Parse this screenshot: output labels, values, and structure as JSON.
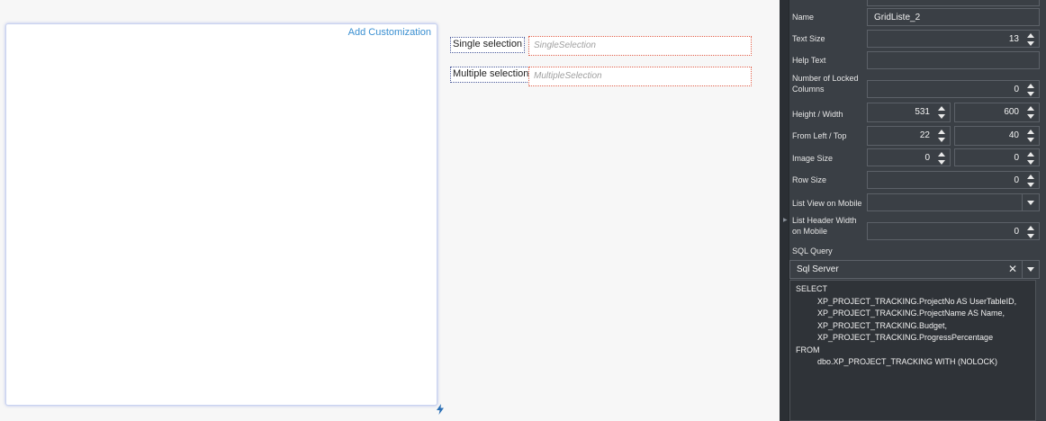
{
  "canvas": {
    "add_customization": "Add Customization",
    "single_selection_label": "Single selection",
    "single_selection_placeholder": "SingleSelection",
    "multiple_selection_label": "Multiple selection",
    "multiple_selection_placeholder": "MultipleSelection"
  },
  "props": {
    "name_label": "Name",
    "name_value": "GridListe_2",
    "text_size_label": "Text Size",
    "text_size_value": "13",
    "help_text_label": "Help Text",
    "help_text_value": "",
    "locked_columns_label": "Number of Locked Columns",
    "locked_columns_value": "0",
    "height_width_label": "Height / Width",
    "height_value": "531",
    "width_value": "600",
    "from_left_top_label": "From Left / Top",
    "left_value": "22",
    "top_value": "40",
    "image_size_label": "Image Size",
    "image_w_value": "0",
    "image_h_value": "0",
    "row_size_label": "Row Size",
    "row_size_value": "0",
    "list_view_mobile_label": "List View on Mobile",
    "list_view_mobile_value": "",
    "list_header_width_label": "List Header Width on Mobile",
    "list_header_width_value": "0",
    "sql_query_label": "SQL Query",
    "sql_server_value": "Sql Server",
    "sql_lines": [
      "SELECT",
      "XP_PROJECT_TRACKING.ProjectNo AS UserTableID,",
      "XP_PROJECT_TRACKING.ProjectName AS Name,",
      "XP_PROJECT_TRACKING.Budget,",
      "XP_PROJECT_TRACKING.ProgressPercentage",
      "FROM",
      "dbo.XP_PROJECT_TRACKING WITH (NOLOCK)"
    ]
  },
  "colors": {
    "panel_bg": "#3a3f45",
    "link": "#3a8fd1",
    "field_border": "#e0604a"
  }
}
